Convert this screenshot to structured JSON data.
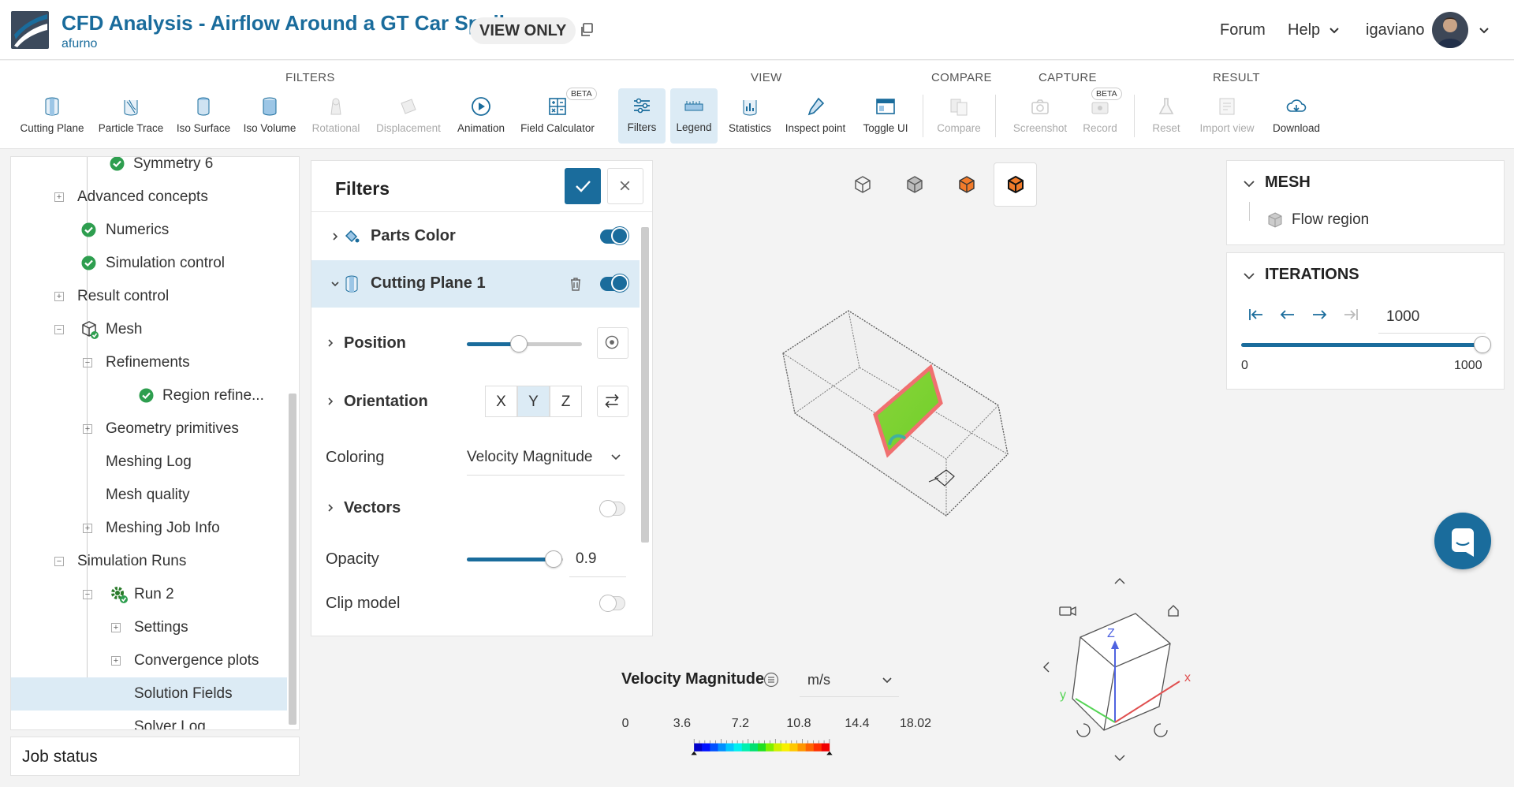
{
  "header": {
    "title": "CFD Analysis - Airflow Around a GT Car Spoiler",
    "owner": "afurno",
    "badge": "VIEW ONLY",
    "nav": {
      "forum": "Forum",
      "help": "Help",
      "user": "igaviano"
    }
  },
  "toolbar": {
    "groups": {
      "filters": "FILTERS",
      "view": "VIEW",
      "compare": "COMPARE",
      "capture": "CAPTURE",
      "result": "RESULT"
    },
    "beta": "BETA",
    "tools": {
      "cutting_plane": "Cutting Plane",
      "particle_trace": "Particle Trace",
      "iso_surface": "Iso Surface",
      "iso_volume": "Iso Volume",
      "rotational": "Rotational",
      "displacement": "Displacement",
      "animation": "Animation",
      "field_calculator": "Field Calculator",
      "filters": "Filters",
      "legend": "Legend",
      "statistics": "Statistics",
      "inspect_point": "Inspect point",
      "toggle_ui": "Toggle UI",
      "compare": "Compare",
      "screenshot": "Screenshot",
      "record": "Record",
      "reset": "Reset",
      "import_view": "Import view",
      "download": "Download"
    }
  },
  "tree": {
    "items": [
      {
        "label": "Symmetry 6"
      },
      {
        "label": "Advanced concepts"
      },
      {
        "label": "Numerics"
      },
      {
        "label": "Simulation control"
      },
      {
        "label": "Result control"
      },
      {
        "label": "Mesh"
      },
      {
        "label": "Refinements"
      },
      {
        "label": "Region refine..."
      },
      {
        "label": "Geometry primitives"
      },
      {
        "label": "Meshing Log"
      },
      {
        "label": "Mesh quality"
      },
      {
        "label": "Meshing Job Info"
      },
      {
        "label": "Simulation Runs"
      },
      {
        "label": "Run 2"
      },
      {
        "label": "Settings"
      },
      {
        "label": "Convergence plots"
      },
      {
        "label": "Solution Fields"
      },
      {
        "label": "Solver Log"
      }
    ],
    "job_status": "Job status"
  },
  "filters_panel": {
    "title": "Filters",
    "parts_color": "Parts Color",
    "cutting_plane": "Cutting Plane 1",
    "position": "Position",
    "position_value": 0.45,
    "orientation": "Orientation",
    "axes": [
      "X",
      "Y",
      "Z"
    ],
    "coloring": "Coloring",
    "coloring_value": "Velocity Magnitude",
    "vectors": "Vectors",
    "opacity": "Opacity",
    "opacity_value": "0.9",
    "clip_model": "Clip model"
  },
  "legend": {
    "title": "Velocity Magnitude",
    "unit": "m/s",
    "ticks": [
      "0",
      "3.6",
      "7.2",
      "10.8",
      "14.4",
      "18.02"
    ]
  },
  "mesh_panel": {
    "title": "MESH",
    "item": "Flow region"
  },
  "iterations_panel": {
    "title": "ITERATIONS",
    "value": "1000",
    "min": "0",
    "max": "1000",
    "progress": 1.0
  },
  "colors": {
    "accent": "#1a6c9c",
    "selected": "#dcebf5",
    "check": "#2e9e4f"
  }
}
